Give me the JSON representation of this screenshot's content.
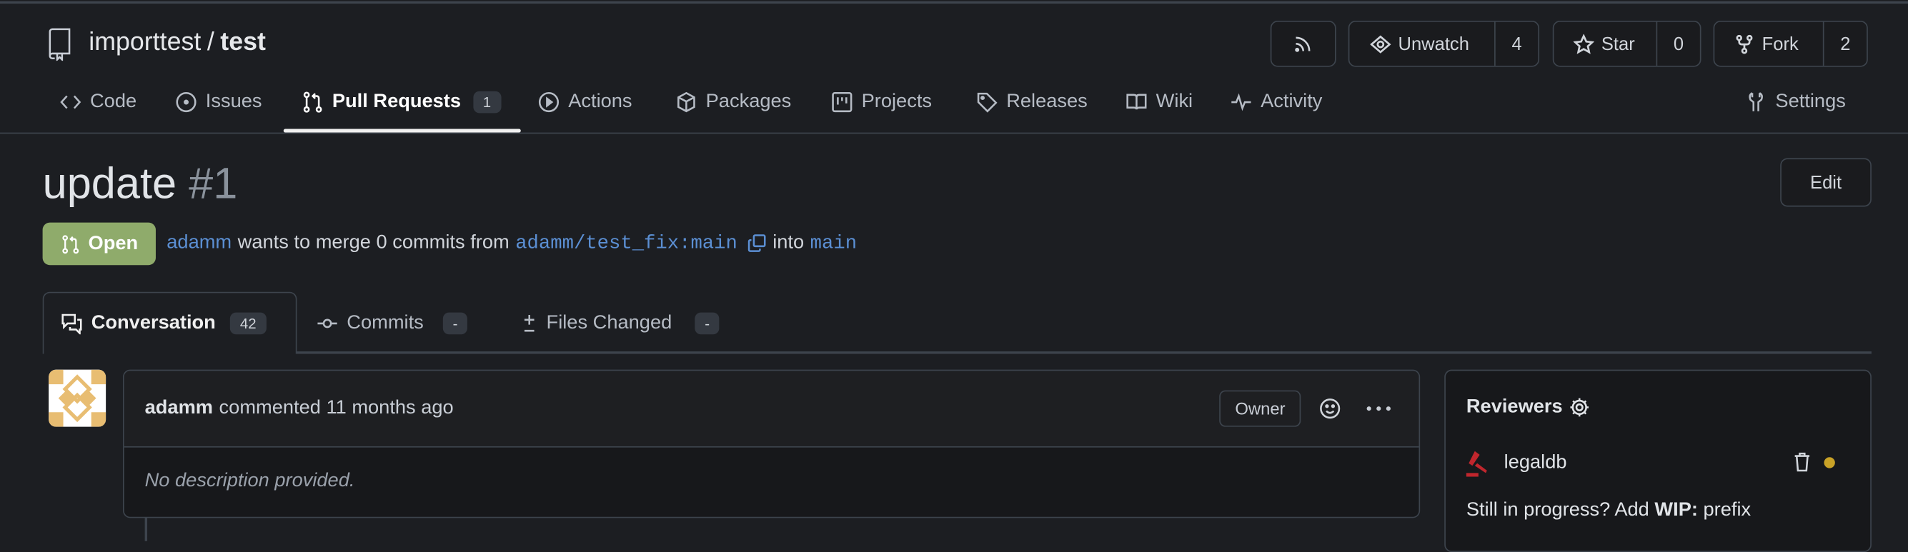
{
  "repo": {
    "owner": "importtest",
    "separator": "/",
    "name": "test"
  },
  "actions": {
    "watch_label": "Unwatch",
    "watch_count": "4",
    "star_label": "Star",
    "star_count": "0",
    "fork_label": "Fork",
    "fork_count": "2"
  },
  "nav": {
    "code": "Code",
    "issues": "Issues",
    "pull_requests": "Pull Requests",
    "pull_requests_count": "1",
    "actions": "Actions",
    "packages": "Packages",
    "projects": "Projects",
    "releases": "Releases",
    "wiki": "Wiki",
    "activity": "Activity",
    "settings": "Settings"
  },
  "pr": {
    "title": "update",
    "number": "#1",
    "edit_label": "Edit",
    "state": "Open",
    "author": "adamm",
    "merge_text": "wants to merge 0 commits from",
    "head_branch": "adamm/test_fix:main",
    "into_text": "into",
    "base_branch": "main"
  },
  "tabs": {
    "conversation": "Conversation",
    "conversation_count": "42",
    "commits": "Commits",
    "commits_count": "-",
    "files": "Files Changed",
    "files_count": "-"
  },
  "comment": {
    "author": "adamm",
    "meta": "commented 11 months ago",
    "role": "Owner",
    "body": "No description provided."
  },
  "sidebar": {
    "reviewers_title": "Reviewers",
    "reviewer": "legaldb",
    "wip_prefix": "Still in progress? Add",
    "wip_bold": "WIP:",
    "wip_suffix": "prefix"
  },
  "colors": {
    "open": "#8fab6b",
    "link": "#5b8fd3",
    "pending": "#c9a227",
    "reviewer_icon": "#c0262d"
  }
}
